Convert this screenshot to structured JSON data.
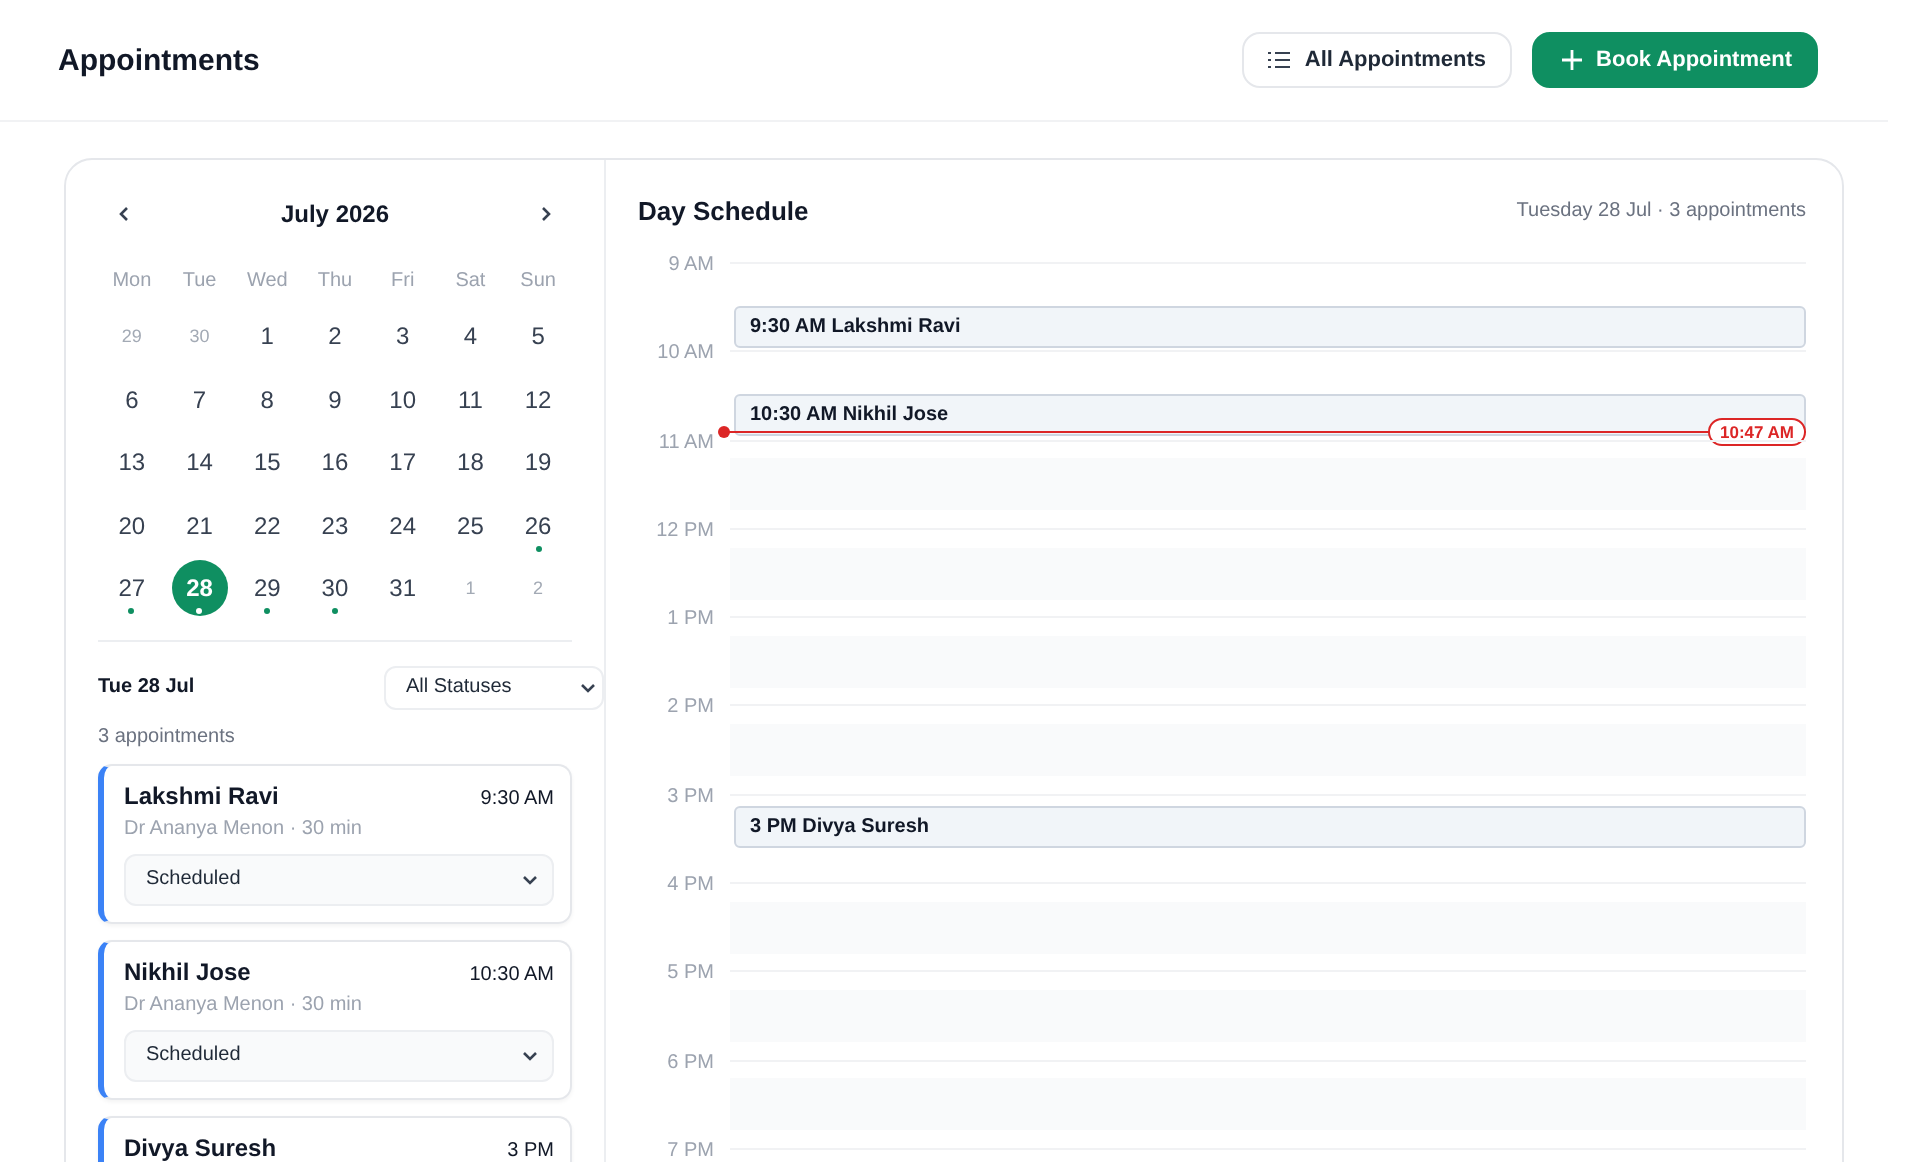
{
  "header": {
    "title": "Appointments",
    "buttons": [
      {
        "kind": "secondary",
        "label": "All Appointments"
      },
      {
        "kind": "primary",
        "label": "Book Appointment"
      }
    ]
  },
  "calendar": {
    "month": "July 2026",
    "weekdays": [
      "Mon",
      "Tue",
      "Wed",
      "Thu",
      "Fri",
      "Sat",
      "Sun"
    ],
    "days": [
      {
        "label": "29",
        "muted": true,
        "selected": false,
        "dot": false
      },
      {
        "label": "30",
        "muted": true,
        "selected": false,
        "dot": false
      },
      {
        "label": "1",
        "muted": false,
        "selected": false,
        "dot": false
      },
      {
        "label": "2",
        "muted": false,
        "selected": false,
        "dot": false
      },
      {
        "label": "3",
        "muted": false,
        "selected": false,
        "dot": false
      },
      {
        "label": "4",
        "muted": false,
        "selected": false,
        "dot": false
      },
      {
        "label": "5",
        "muted": false,
        "selected": false,
        "dot": false
      },
      {
        "label": "6",
        "muted": false,
        "selected": false,
        "dot": false
      },
      {
        "label": "7",
        "muted": false,
        "selected": false,
        "dot": false
      },
      {
        "label": "8",
        "muted": false,
        "selected": false,
        "dot": false
      },
      {
        "label": "9",
        "muted": false,
        "selected": false,
        "dot": false
      },
      {
        "label": "10",
        "muted": false,
        "selected": false,
        "dot": false
      },
      {
        "label": "11",
        "muted": false,
        "selected": false,
        "dot": false
      },
      {
        "label": "12",
        "muted": false,
        "selected": false,
        "dot": false
      },
      {
        "label": "13",
        "muted": false,
        "selected": false,
        "dot": false
      },
      {
        "label": "14",
        "muted": false,
        "selected": false,
        "dot": false
      },
      {
        "label": "15",
        "muted": false,
        "selected": false,
        "dot": false
      },
      {
        "label": "16",
        "muted": false,
        "selected": false,
        "dot": false
      },
      {
        "label": "17",
        "muted": false,
        "selected": false,
        "dot": false
      },
      {
        "label": "18",
        "muted": false,
        "selected": false,
        "dot": false
      },
      {
        "label": "19",
        "muted": false,
        "selected": false,
        "dot": false
      },
      {
        "label": "20",
        "muted": false,
        "selected": false,
        "dot": false
      },
      {
        "label": "21",
        "muted": false,
        "selected": false,
        "dot": false
      },
      {
        "label": "22",
        "muted": false,
        "selected": false,
        "dot": false
      },
      {
        "label": "23",
        "muted": false,
        "selected": false,
        "dot": false
      },
      {
        "label": "24",
        "muted": false,
        "selected": false,
        "dot": false
      },
      {
        "label": "25",
        "muted": false,
        "selected": false,
        "dot": false
      },
      {
        "label": "26",
        "muted": false,
        "selected": false,
        "dot": true
      },
      {
        "label": "27",
        "muted": false,
        "selected": false,
        "dot": true
      },
      {
        "label": "28",
        "muted": false,
        "selected": true,
        "dot": true
      },
      {
        "label": "29",
        "muted": false,
        "selected": false,
        "dot": true
      },
      {
        "label": "30",
        "muted": false,
        "selected": false,
        "dot": true
      },
      {
        "label": "31",
        "muted": false,
        "selected": false,
        "dot": false
      },
      {
        "label": "1",
        "muted": true,
        "selected": false,
        "dot": false
      },
      {
        "label": "2",
        "muted": true,
        "selected": false,
        "dot": false
      }
    ]
  },
  "day_list": {
    "date": "Tue 28 Jul",
    "count": "3 appointments",
    "filter": "All Statuses",
    "appointments": [
      {
        "name": "Lakshmi Ravi",
        "time": "9:30 AM",
        "detail": "Dr Ananya Menon · 30 min",
        "status": "Scheduled"
      },
      {
        "name": "Nikhil Jose",
        "time": "10:30 AM",
        "detail": "Dr Ananya Menon · 30 min",
        "status": "Scheduled"
      },
      {
        "name": "Divya Suresh",
        "time": "3 PM"
      }
    ]
  },
  "schedule": {
    "title": "Day Schedule",
    "summary": "Tuesday 28 Jul · 3 appointments",
    "hours": [
      {
        "label": "9 AM",
        "events": [
          {
            "kind": "half",
            "label": "9:30 AM Lakshmi Ravi"
          }
        ]
      },
      {
        "label": "10 AM",
        "events": [
          {
            "kind": "half",
            "label": "10:30 AM Nikhil Jose"
          }
        ],
        "now": "10:47 AM"
      },
      {
        "label": "11 AM"
      },
      {
        "label": "12 PM"
      },
      {
        "label": "1 PM"
      },
      {
        "label": "2 PM"
      },
      {
        "label": "3 PM",
        "events": [
          {
            "kind": "full",
            "label": "3 PM Divya Suresh"
          }
        ]
      },
      {
        "label": "4 PM"
      },
      {
        "label": "5 PM"
      },
      {
        "label": "6 PM"
      },
      {
        "label": "7 PM"
      }
    ]
  }
}
